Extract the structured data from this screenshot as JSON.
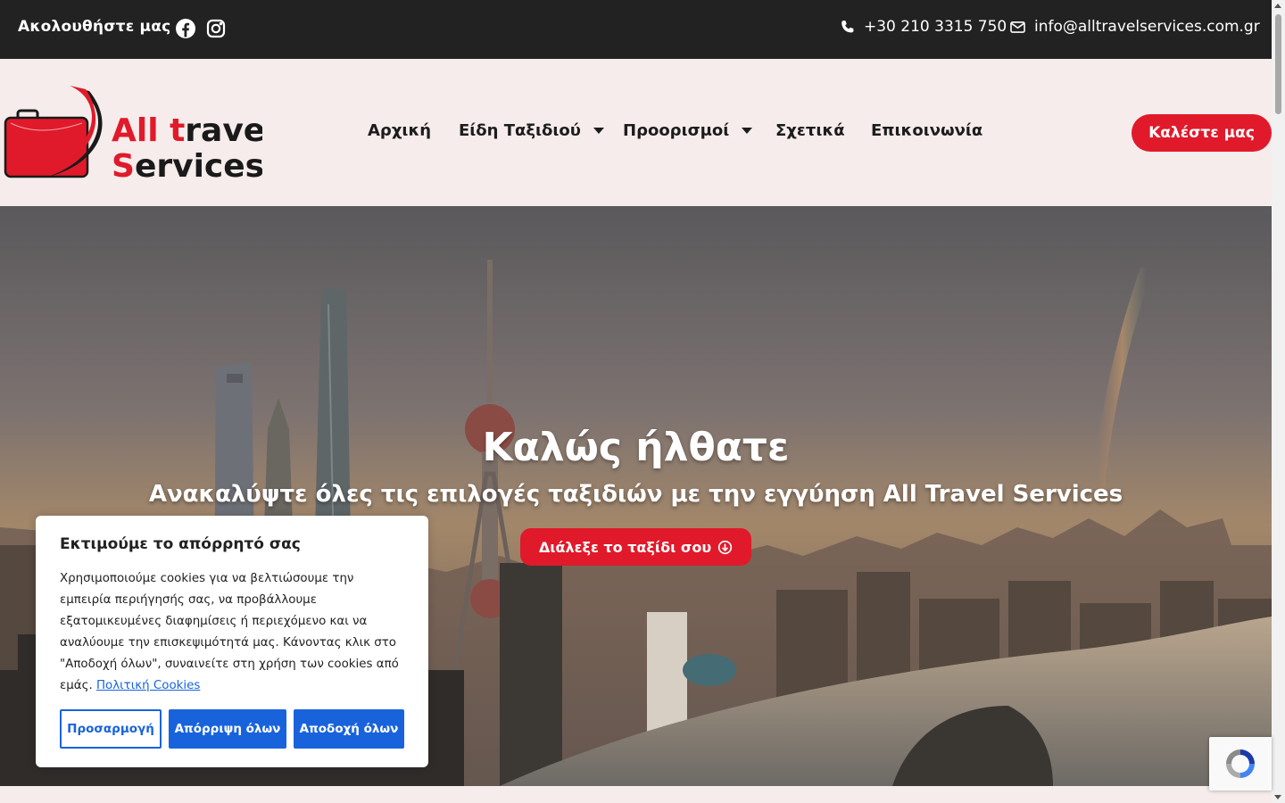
{
  "topbar": {
    "follow_label": "Ακολουθήστε μας :",
    "social": [
      "facebook-icon",
      "instagram-icon"
    ],
    "phone": "+30 210 3315 750",
    "email": "info@alltravelservices.com.gr"
  },
  "header": {
    "logo": {
      "line1_a": "All ",
      "line1_t": "t",
      "line1_b": "ravel",
      "line2_s": "S",
      "line2_b": "ervices"
    },
    "nav": [
      {
        "label": "Αρχική",
        "dropdown": false
      },
      {
        "label": "Είδη Ταξιδιού",
        "dropdown": true
      },
      {
        "label": "Προορισμοί",
        "dropdown": true
      },
      {
        "label": "Σχετικά",
        "dropdown": false
      },
      {
        "label": "Επικοινωνία",
        "dropdown": false
      }
    ],
    "call_button": "Καλέστε μας"
  },
  "hero": {
    "title": "Καλώς ήλθατε",
    "subtitle": "Ανακαλύψτε όλες τις επιλογές ταξιδιών με την εγγύηση All Travel Services",
    "button": "Διάλεξε το ταξίδι σου"
  },
  "cookie": {
    "title": "Εκτιμούμε το απόρρητό σας",
    "text": "Χρησιμοποιούμε cookies για να βελτιώσουμε την εμπειρία περιήγησής σας, να προβάλλουμε εξατομικευμένες διαφημίσεις ή περιεχόμενο και να αναλύουμε την επισκεψιμότητά μας. Κάνοντας κλικ στο \"Αποδοχή όλων\", συναινείτε στη χρήση των cookies από εμάς.",
    "policy_link": "Πολιτική Cookies",
    "customize": "Προσαρμογή",
    "reject": "Απόρριψη όλων",
    "accept": "Αποδοχή όλων"
  },
  "colors": {
    "accent_red": "#e01a2a",
    "topbar_bg": "#222222",
    "header_bg": "#f5eceb",
    "cookie_blue": "#1863dc"
  }
}
